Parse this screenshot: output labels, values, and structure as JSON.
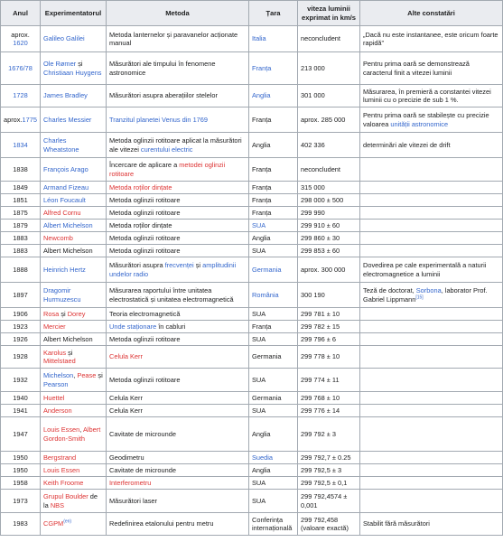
{
  "headers": [
    "Anul",
    "Experimentatorul",
    "Metoda",
    "Țara",
    "viteza luminii exprimat in km/s",
    "Alte constatări"
  ],
  "rows": [
    {
      "h": 29,
      "year": {
        "t": "aprox.",
        "u": "1620",
        "ul": "b"
      },
      "exp": [
        {
          "t": "Galileo Galilei",
          "c": "b"
        }
      ],
      "method": [
        {
          "t": "Metoda lanternelor și paravanelor acționate manual",
          "c": "k"
        }
      ],
      "country": {
        "t": "Italia",
        "c": "b"
      },
      "speed": "neconcludent",
      "notes": [
        {
          "t": "„Dacă nu este instantanee, este oricum foarte rapidă”",
          "c": "k"
        }
      ]
    },
    {
      "h": 36,
      "year": {
        "t": "1676/78",
        "c": "b"
      },
      "exp": [
        {
          "t": "Ole Rømer",
          "c": "b"
        },
        {
          "t": " și ",
          "c": "k"
        },
        {
          "t": "Christiaan Huygens",
          "c": "b"
        }
      ],
      "method": [
        {
          "t": "Măsurători ale timpului în fenomene astronomice",
          "c": "k"
        }
      ],
      "country": {
        "t": "Franța",
        "c": "b"
      },
      "speed": "213 000",
      "notes": [
        {
          "t": "Pentru prima oară se demonstrează caracterul finit a vitezei luminii",
          "c": "k"
        }
      ]
    },
    {
      "h": 25,
      "year": {
        "t": "1728",
        "c": "b"
      },
      "exp": [
        {
          "t": "James Bradley",
          "c": "b"
        }
      ],
      "method": [
        {
          "t": "Măsurători asupra aberațiilor stelelor",
          "c": "k"
        }
      ],
      "country": {
        "t": "Anglia",
        "c": "b"
      },
      "speed": "301 000",
      "notes": [
        {
          "t": "Măsurarea, în premieră a constantei vitezei luminii cu o precizie de sub 1 %.",
          "c": "k"
        }
      ]
    },
    {
      "h": 28,
      "year": {
        "t": "aprox.",
        "u": "1775",
        "ul": "b",
        "inline": true
      },
      "exp": [
        {
          "t": "Charles Messier",
          "c": "b"
        }
      ],
      "method": [
        {
          "t": "Tranzitul planetei Venus din 1769",
          "c": "b"
        }
      ],
      "country": {
        "t": "Franța",
        "c": "k"
      },
      "speed": "aprox. 285 000",
      "notes": [
        {
          "t": "Pentru prima oară se stabilește cu precizie valoarea ",
          "c": "k"
        },
        {
          "t": "unității astronomice",
          "c": "b"
        }
      ]
    },
    {
      "h": 28,
      "year": {
        "t": "1834",
        "c": "b"
      },
      "exp": [
        {
          "t": "Charles Wheatstone",
          "c": "b"
        }
      ],
      "method": [
        {
          "t": "Metoda oglinzii rotitoare aplicat la măsurători ale vitezei ",
          "c": "k"
        },
        {
          "t": "curentului electric",
          "c": "b"
        }
      ],
      "country": {
        "t": "Anglia",
        "c": "k"
      },
      "speed": "402 336",
      "notes": [
        {
          "t": "determinări ale vitezei de drift",
          "c": "k"
        }
      ]
    },
    {
      "h": 26,
      "year": {
        "t": "1838",
        "c": "k"
      },
      "exp": [
        {
          "t": "François Arago",
          "c": "b"
        }
      ],
      "method": [
        {
          "t": "Încercare de aplicare a ",
          "c": "k"
        },
        {
          "t": "metodei oglinzii rotitoare",
          "c": "r"
        }
      ],
      "country": {
        "t": "Franța",
        "c": "k"
      },
      "speed": "neconcludent",
      "notes": []
    },
    {
      "h": 14,
      "year": {
        "t": "1849",
        "c": "k"
      },
      "exp": [
        {
          "t": "Armand Fizeau",
          "c": "b"
        }
      ],
      "method": [
        {
          "t": "Metoda roților dințate",
          "c": "r"
        }
      ],
      "country": {
        "t": "Franța",
        "c": "k"
      },
      "speed": "315 000",
      "notes": []
    },
    {
      "h": 14,
      "year": {
        "t": "1851",
        "c": "k"
      },
      "exp": [
        {
          "t": "Léon Foucault",
          "c": "b"
        }
      ],
      "method": [
        {
          "t": "Metoda oglinzii rotitoare",
          "c": "k"
        }
      ],
      "country": {
        "t": "Franța",
        "c": "k"
      },
      "speed": "298 000 ± 500",
      "notes": []
    },
    {
      "h": 14,
      "year": {
        "t": "1875",
        "c": "k"
      },
      "exp": [
        {
          "t": "Alfred Cornu",
          "c": "r"
        }
      ],
      "method": [
        {
          "t": "Metoda oglinzii rotitoare",
          "c": "k"
        }
      ],
      "country": {
        "t": "Franța",
        "c": "k"
      },
      "speed": "299 990",
      "notes": []
    },
    {
      "h": 14,
      "year": {
        "t": "1879",
        "c": "k"
      },
      "exp": [
        {
          "t": "Albert Michelson",
          "c": "b"
        }
      ],
      "method": [
        {
          "t": "Metoda roților dințate",
          "c": "k"
        }
      ],
      "country": {
        "t": "SUA",
        "c": "b"
      },
      "speed": "299 910 ± 60",
      "notes": []
    },
    {
      "h": 14,
      "year": {
        "t": "1883",
        "c": "k"
      },
      "exp": [
        {
          "t": "Newcomb",
          "c": "r"
        }
      ],
      "method": [
        {
          "t": "Metoda oglinzii rotitoare",
          "c": "k"
        }
      ],
      "country": {
        "t": "Anglia",
        "c": "k"
      },
      "speed": "299 860 ± 30",
      "notes": []
    },
    {
      "h": 14,
      "year": {
        "t": "1883",
        "c": "k"
      },
      "exp": [
        {
          "t": "Albert Michelson",
          "c": "k"
        }
      ],
      "method": [
        {
          "t": "Metoda oglinzii rotitoare",
          "c": "k"
        }
      ],
      "country": {
        "t": "SUA",
        "c": "k"
      },
      "speed": "299 853 ± 60",
      "notes": []
    },
    {
      "h": 28,
      "year": {
        "t": "1888",
        "c": "k"
      },
      "exp": [
        {
          "t": "Heinrich Hertz",
          "c": "b"
        }
      ],
      "method": [
        {
          "t": "Măsurători asupra ",
          "c": "k"
        },
        {
          "t": "frecvenței",
          "c": "b"
        },
        {
          "t": " și ",
          "c": "k"
        },
        {
          "t": "amplitudinii",
          "c": "b"
        },
        {
          "t": " ",
          "c": "k"
        },
        {
          "t": "undelor radio",
          "c": "b"
        }
      ],
      "country": {
        "t": "Germania",
        "c": "b"
      },
      "speed": "aprox. 300 000",
      "notes": [
        {
          "t": "Dovedirea pe cale experimentală a naturii electromagnetice a luminii",
          "c": "k"
        }
      ]
    },
    {
      "h": 28,
      "year": {
        "t": "1897",
        "c": "k"
      },
      "exp": [
        {
          "t": "Dragomir Hurmuzescu",
          "c": "b"
        }
      ],
      "method": [
        {
          "t": "Măsurarea raportului între unitatea electrostatică și unitatea electromagnetică",
          "c": "k"
        }
      ],
      "country": {
        "t": "România",
        "c": "b"
      },
      "speed": "300 190",
      "notes": [
        {
          "t": "Teză de doctorat, ",
          "c": "k"
        },
        {
          "t": "Sorbona",
          "c": "b"
        },
        {
          "t": ", laborator Prof. Gabriel Lippmann",
          "c": "k"
        },
        {
          "t": "[15]",
          "c": "b",
          "sup": true
        }
      ]
    },
    {
      "h": 14,
      "year": {
        "t": "1906",
        "c": "k"
      },
      "exp": [
        {
          "t": "Rosa",
          "c": "r"
        },
        {
          "t": " și ",
          "c": "k"
        },
        {
          "t": "Dorey",
          "c": "r"
        }
      ],
      "method": [
        {
          "t": "Teoria electromagnetică",
          "c": "k"
        }
      ],
      "country": {
        "t": "SUA",
        "c": "k"
      },
      "speed": "299 781 ± 10",
      "notes": []
    },
    {
      "h": 14,
      "year": {
        "t": "1923",
        "c": "k"
      },
      "exp": [
        {
          "t": "Mercier",
          "c": "r"
        }
      ],
      "method": [
        {
          "t": "Unde staționare",
          "c": "b"
        },
        {
          "t": " în cabluri",
          "c": "k"
        }
      ],
      "country": {
        "t": "Franța",
        "c": "k"
      },
      "speed": "299 782 ± 15",
      "notes": []
    },
    {
      "h": 14,
      "year": {
        "t": "1926",
        "c": "k"
      },
      "exp": [
        {
          "t": "Albert Michelson",
          "c": "k"
        }
      ],
      "method": [
        {
          "t": "Metoda oglinzii rotitoare",
          "c": "k"
        }
      ],
      "country": {
        "t": "SUA",
        "c": "k"
      },
      "speed": "299 796 ± 6",
      "notes": []
    },
    {
      "h": 25,
      "year": {
        "t": "1928",
        "c": "k"
      },
      "exp": [
        {
          "t": "Karolus",
          "c": "r"
        },
        {
          "t": " și ",
          "c": "k"
        },
        {
          "t": "Mittelstaed",
          "c": "r"
        }
      ],
      "method": [
        {
          "t": "Celula Kerr",
          "c": "r"
        }
      ],
      "country": {
        "t": "Germania",
        "c": "k"
      },
      "speed": "299 778 ± 10",
      "notes": []
    },
    {
      "h": 26,
      "year": {
        "t": "1932",
        "c": "k"
      },
      "exp": [
        {
          "t": "Michelson",
          "c": "b"
        },
        {
          "t": ", ",
          "c": "k"
        },
        {
          "t": "Pease",
          "c": "r"
        },
        {
          "t": " și ",
          "c": "k"
        },
        {
          "t": "Pearson",
          "c": "b"
        }
      ],
      "method": [
        {
          "t": "Metoda oglinzii rotitoare",
          "c": "k"
        }
      ],
      "country": {
        "t": "SUA",
        "c": "k"
      },
      "speed": "299 774 ± 11",
      "notes": []
    },
    {
      "h": 14,
      "year": {
        "t": "1940",
        "c": "k"
      },
      "exp": [
        {
          "t": "Huettel",
          "c": "r"
        }
      ],
      "method": [
        {
          "t": "Celula Kerr",
          "c": "k"
        }
      ],
      "country": {
        "t": "Germania",
        "c": "k"
      },
      "speed": "299 768 ± 10",
      "notes": []
    },
    {
      "h": 14,
      "year": {
        "t": "1941",
        "c": "k"
      },
      "exp": [
        {
          "t": "Anderson",
          "c": "r"
        }
      ],
      "method": [
        {
          "t": "Celula Kerr",
          "c": "k"
        }
      ],
      "country": {
        "t": "SUA",
        "c": "k"
      },
      "speed": "299 776 ± 14",
      "notes": []
    },
    {
      "h": 38,
      "year": {
        "t": "1947",
        "c": "k"
      },
      "exp": [
        {
          "t": "Louis Essen",
          "c": "r"
        },
        {
          "t": ", ",
          "c": "k"
        },
        {
          "t": "Albert Gordon-Smith",
          "c": "r"
        }
      ],
      "method": [
        {
          "t": "Cavitate de microunde",
          "c": "k"
        }
      ],
      "country": {
        "t": "Anglia",
        "c": "k"
      },
      "speed": "299 792 ± 3",
      "notes": []
    },
    {
      "h": 14,
      "year": {
        "t": "1950",
        "c": "k"
      },
      "exp": [
        {
          "t": "Bergstrand",
          "c": "r"
        }
      ],
      "method": [
        {
          "t": "Geodimetru",
          "c": "k"
        }
      ],
      "country": {
        "t": "Suedia",
        "c": "b"
      },
      "speed": "299 792,7 ± 0.25",
      "notes": []
    },
    {
      "h": 14,
      "year": {
        "t": "1950",
        "c": "k"
      },
      "exp": [
        {
          "t": "Louis Essen",
          "c": "r"
        }
      ],
      "method": [
        {
          "t": "Cavitate de microunde",
          "c": "k"
        }
      ],
      "country": {
        "t": "Anglia",
        "c": "k"
      },
      "speed": "299 792,5 ± 3",
      "notes": []
    },
    {
      "h": 14,
      "year": {
        "t": "1958",
        "c": "k"
      },
      "exp": [
        {
          "t": "Keith Froome",
          "c": "r"
        }
      ],
      "method": [
        {
          "t": "Interferometru",
          "c": "r"
        }
      ],
      "country": {
        "t": "SUA",
        "c": "k"
      },
      "speed": "299 792,5 ± 0,1",
      "notes": []
    },
    {
      "h": 26,
      "year": {
        "t": "1973",
        "c": "k"
      },
      "exp": [
        {
          "t": "Grupul Boulder",
          "c": "r"
        },
        {
          "t": " de la ",
          "c": "k"
        },
        {
          "t": "NBS",
          "c": "r"
        }
      ],
      "method": [
        {
          "t": "Măsurători laser",
          "c": "k"
        }
      ],
      "country": {
        "t": "SUA",
        "c": "k"
      },
      "speed": "299 792,4574 ± 0,001",
      "notes": []
    },
    {
      "h": 25,
      "year": {
        "t": "1983",
        "c": "k"
      },
      "exp": [
        {
          "t": "CGPM",
          "c": "r"
        },
        {
          "t": "(en)",
          "c": "b",
          "sup": true
        }
      ],
      "method": [
        {
          "t": "Redefinirea etalonului pentru metru",
          "c": "k"
        }
      ],
      "country": {
        "t": "Conferința internațională",
        "c": "k"
      },
      "speed": "299 792,458 (valoare exactă)",
      "notes": [
        {
          "t": "Stabilit fără măsurători",
          "c": "k"
        }
      ]
    }
  ]
}
